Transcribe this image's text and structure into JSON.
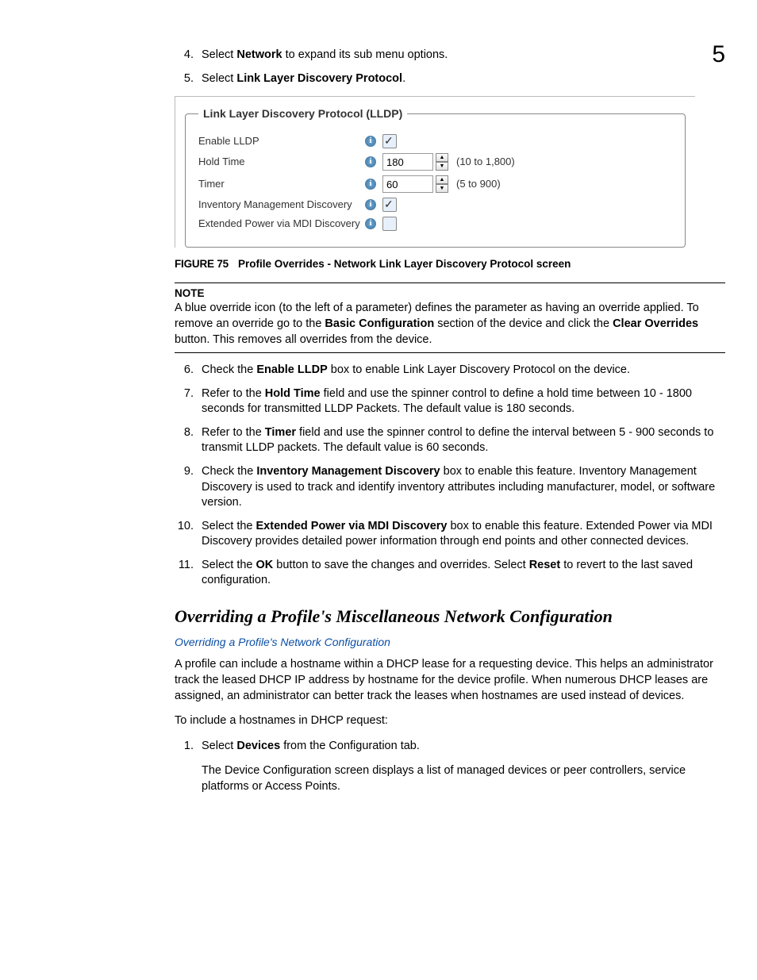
{
  "chapterNum": "5",
  "step4": {
    "pre": "Select ",
    "bold": "Network",
    "post": " to expand its sub menu options."
  },
  "step5": {
    "pre": "Select ",
    "bold": "Link Layer Discovery Protocol",
    "post": "."
  },
  "panel": {
    "legend": "Link Layer Discovery Protocol (LLDP)",
    "rows": {
      "enable": {
        "label": "Enable LLDP",
        "checked": true
      },
      "hold": {
        "label": "Hold Time",
        "value": "180",
        "range": "(10 to 1,800)"
      },
      "timer": {
        "label": "Timer",
        "value": "60",
        "range": "(5 to 900)"
      },
      "inv": {
        "label": "Inventory Management Discovery",
        "checked": true
      },
      "ext": {
        "label": "Extended Power via MDI Discovery",
        "checked": false
      }
    }
  },
  "figure": {
    "num": "FIGURE 75",
    "title": "Profile Overrides - Network Link Layer Discovery Protocol screen"
  },
  "note": {
    "label": "NOTE",
    "p1": "A blue override icon (to the left of a parameter) defines the parameter as having an override applied. To remove an override go to the ",
    "b1": "Basic Configuration",
    "p2": " section of the device and click the ",
    "b2": "Clear Overrides",
    "p3": " button. This removes all overrides from the device."
  },
  "step6": {
    "pre": "Check the ",
    "bold": "Enable LLDP",
    "post": " box to enable Link Layer Discovery Protocol on the device."
  },
  "step7": {
    "pre": "Refer to the ",
    "bold": "Hold Time",
    "post": " field and use the spinner control to define a hold time between 10 - 1800 seconds for transmitted LLDP Packets. The default value is 180 seconds."
  },
  "step8": {
    "pre": "Refer to the ",
    "bold": "Timer",
    "post": " field and use the spinner control to define the interval between 5 - 900 seconds to transmit LLDP packets. The default value is 60 seconds."
  },
  "step9": {
    "pre": "Check the ",
    "bold": "Inventory Management Discovery",
    "post": " box to enable this feature. Inventory Management Discovery is used to track and identify inventory attributes including manufacturer, model, or software version."
  },
  "step10": {
    "pre": "Select the ",
    "bold": "Extended Power via MDI Discovery",
    "post": " box to enable this feature. Extended Power via MDI Discovery provides detailed power information through end points and other connected devices."
  },
  "step11": {
    "pre": "Select the ",
    "b1": "OK",
    "mid": " button to save the changes and overrides. Select ",
    "b2": "Reset",
    "post": " to revert to the last saved configuration."
  },
  "sectionHeading": "Overriding a Profile's Miscellaneous Network Configuration",
  "breadcrumb": "Overriding a Profile's Network Configuration",
  "profilePara": "A profile can include a hostname within a DHCP lease for a requesting device. This helps an administrator track the leased DHCP IP address by hostname for the device profile. When numerous DHCP leases are assigned, an administrator can better track the leases when hostnames are used instead of devices.",
  "toInclude": "To include a hostnames in DHCP request:",
  "newStep1": {
    "pre": "Select ",
    "bold": "Devices",
    "post": " from the Configuration tab."
  },
  "newStep1sub": "The Device Configuration screen displays a list of managed devices or peer controllers, service platforms or Access Points."
}
